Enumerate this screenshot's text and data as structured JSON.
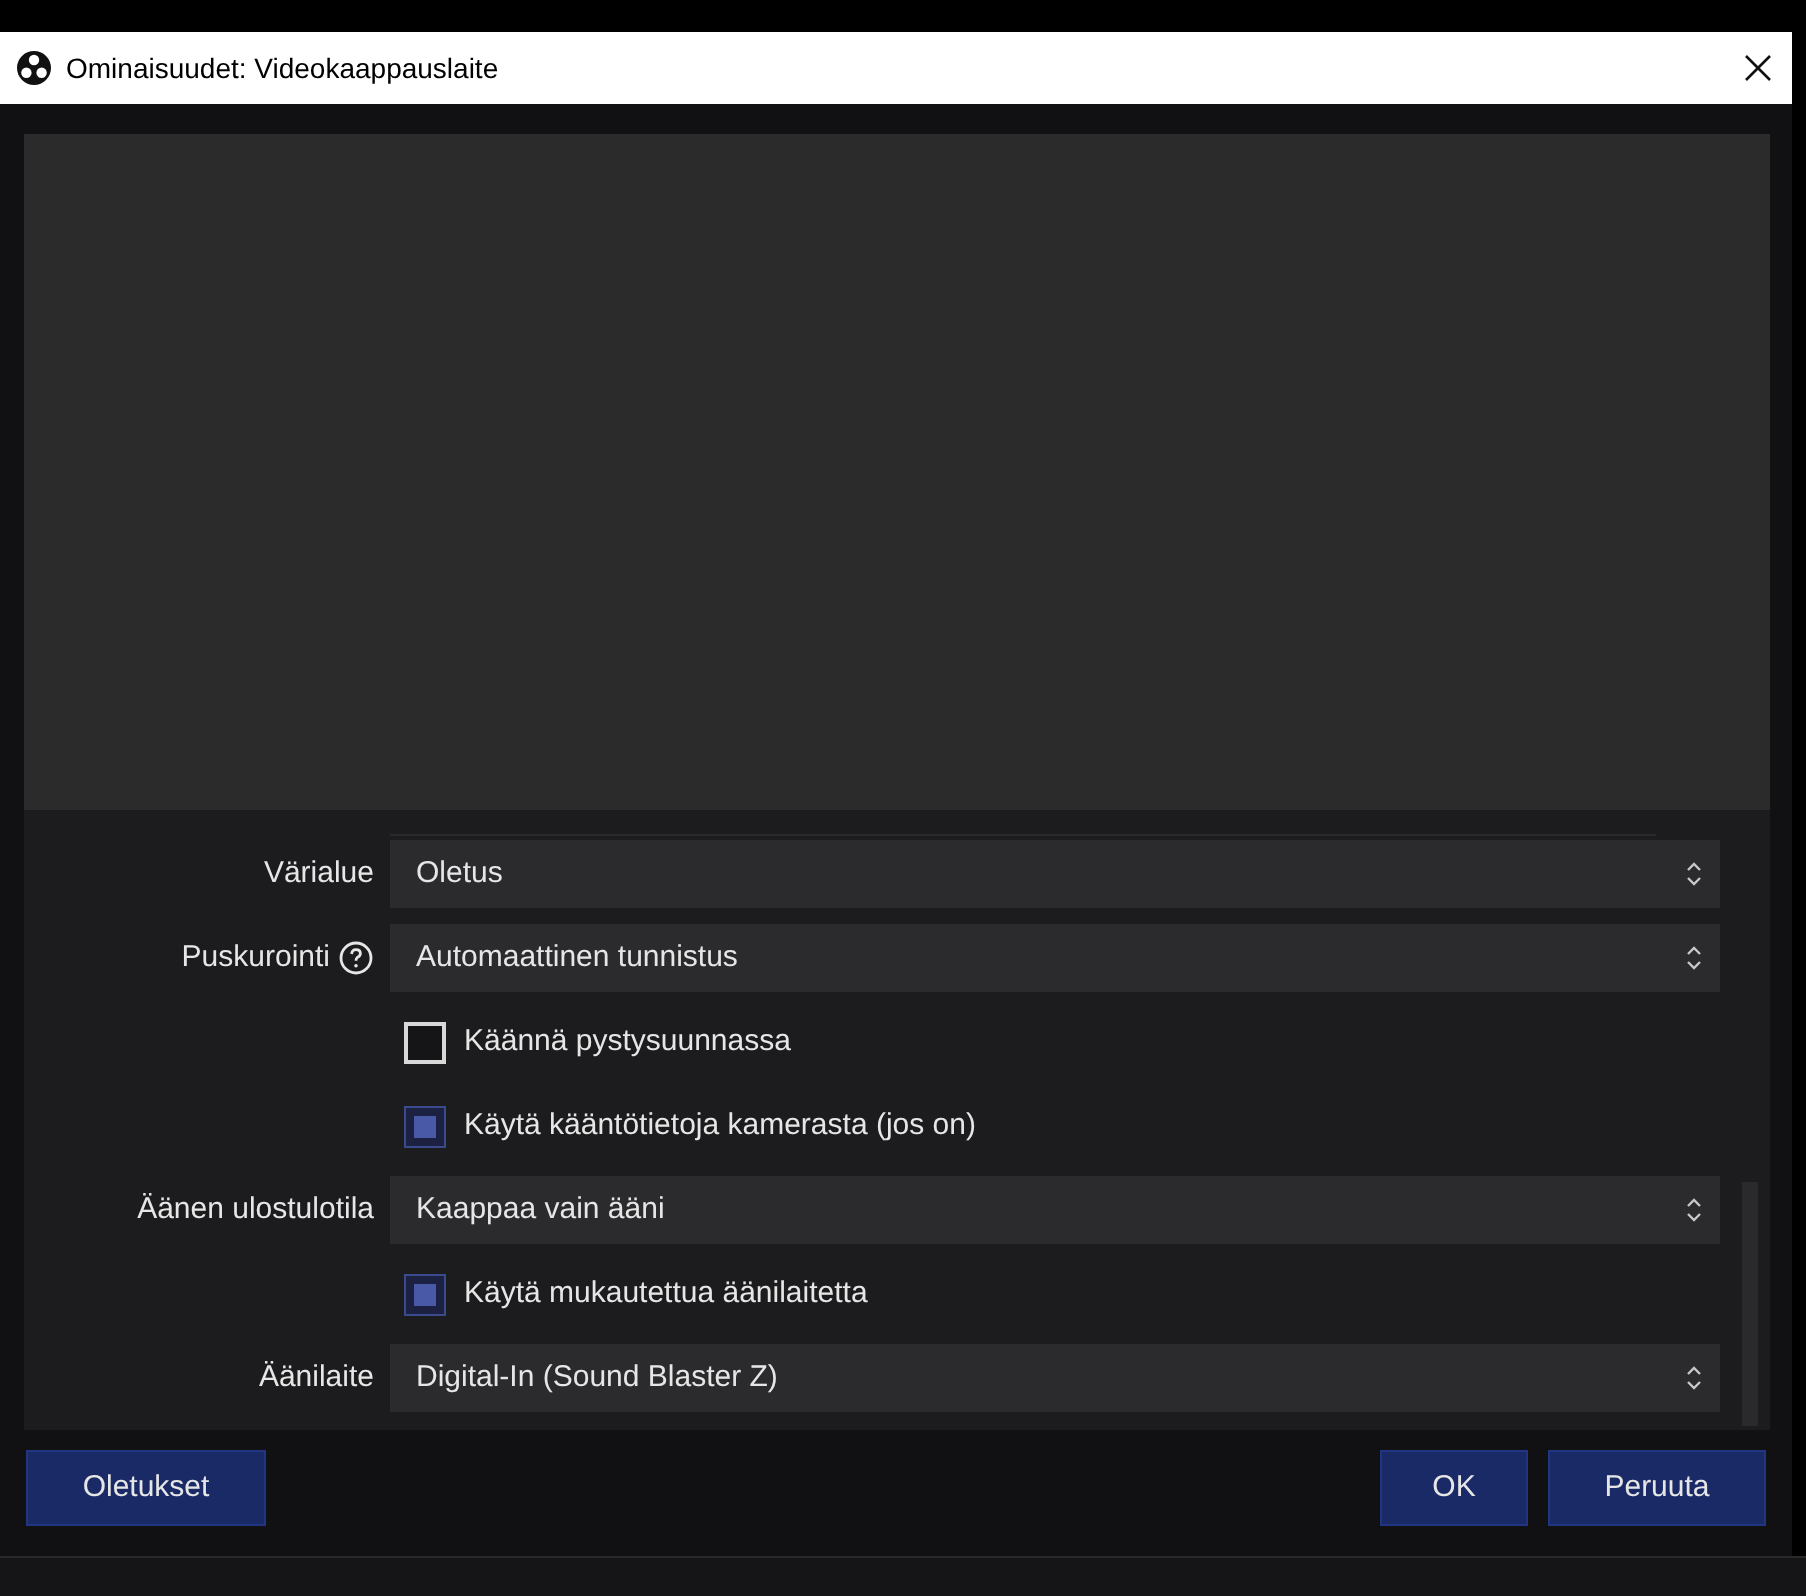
{
  "window": {
    "title": "Ominaisuudet: Videokaappauslaite"
  },
  "rows": [
    {
      "kind": "select",
      "label": "Värialue",
      "value": "Oletus",
      "help": false
    },
    {
      "kind": "select",
      "label": "Puskurointi",
      "value": "Automaattinen tunnistus",
      "help": true
    },
    {
      "kind": "checkbox",
      "label": "Käännä pystysuunnassa",
      "checked": false
    },
    {
      "kind": "checkbox",
      "label": "Käytä kääntötietoja kamerasta (jos on)",
      "checked": true
    },
    {
      "kind": "select",
      "label": "Äänen ulostulotila",
      "value": "Kaappaa vain ääni",
      "help": false
    },
    {
      "kind": "checkbox",
      "label": "Käytä mukautettua äänilaitetta",
      "checked": true
    },
    {
      "kind": "select",
      "label": "Äänilaite",
      "value": "Digital-In (Sound Blaster Z)",
      "help": false
    }
  ],
  "buttons": {
    "left": [
      "Oletukset"
    ],
    "right": [
      "OK",
      "Peruuta"
    ]
  }
}
